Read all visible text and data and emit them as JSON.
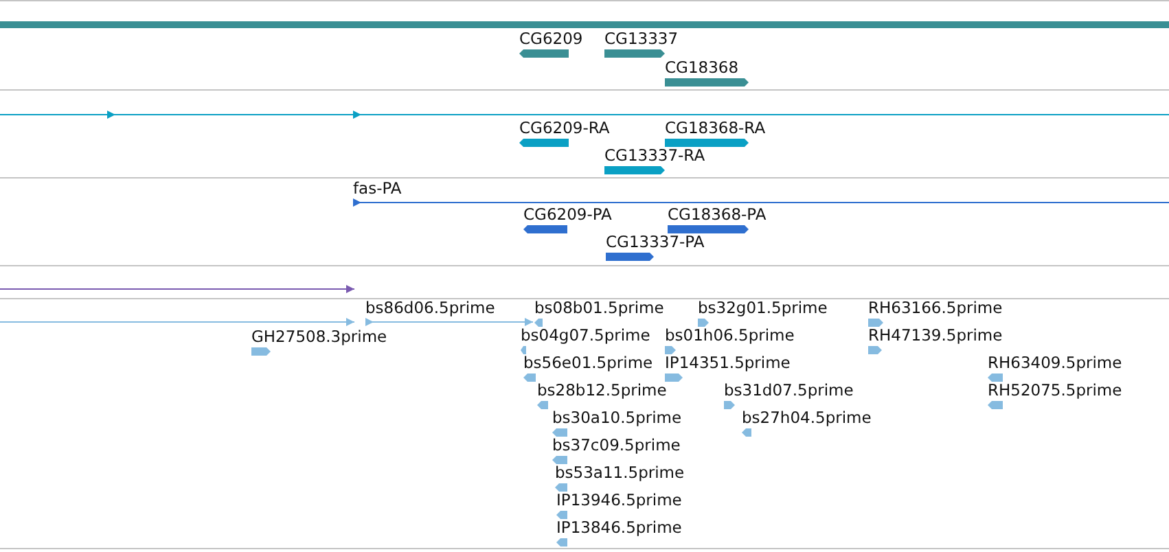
{
  "tracks": [
    {
      "color": "#3a8f94",
      "features": [
        {
          "kind": "band"
        },
        {
          "kind": "block",
          "label": "CG6209",
          "reverse": true
        },
        {
          "kind": "block",
          "label": "CG13337",
          "reverse": false
        },
        {
          "kind": "block",
          "label": "CG18368",
          "reverse": false
        }
      ]
    },
    {
      "color": "#0aa0c4",
      "features": [
        {
          "kind": "line",
          "reverse": false
        },
        {
          "kind": "block",
          "label": "CG6209-RA",
          "reverse": true
        },
        {
          "kind": "block",
          "label": "CG18368-RA",
          "reverse": false
        },
        {
          "kind": "block",
          "label": "CG13337-RA",
          "reverse": false
        }
      ]
    },
    {
      "color": "#2f6fcf",
      "features": [
        {
          "kind": "line",
          "label": "fas-PA",
          "reverse": false
        },
        {
          "kind": "block",
          "label": "CG6209-PA",
          "reverse": true
        },
        {
          "kind": "block",
          "label": "CG18368-PA",
          "reverse": false
        },
        {
          "kind": "block",
          "label": "CG13337-PA",
          "reverse": false
        }
      ]
    },
    {
      "color": "#7a5ab0",
      "features": [
        {
          "kind": "line",
          "reverse": false
        }
      ]
    },
    {
      "color": "#86bbe0",
      "features": [
        {
          "kind": "line",
          "reverse": false
        },
        {
          "kind": "line",
          "label": "bs86d06.5prime",
          "reverse": false
        },
        {
          "kind": "block",
          "label": "bs08b01.5prime",
          "reverse": true
        },
        {
          "kind": "block",
          "label": "bs32g01.5prime",
          "reverse": false
        },
        {
          "kind": "block",
          "label": "RH63166.5prime",
          "reverse": false
        },
        {
          "kind": "block",
          "label": "GH27508.3prime",
          "reverse": false
        },
        {
          "kind": "block",
          "label": "bs04g07.5prime",
          "reverse": true
        },
        {
          "kind": "block",
          "label": "bs01h06.5prime",
          "reverse": false
        },
        {
          "kind": "block",
          "label": "RH47139.5prime",
          "reverse": false
        },
        {
          "kind": "block",
          "label": "bs56e01.5prime",
          "reverse": true
        },
        {
          "kind": "block",
          "label": "IP14351.5prime",
          "reverse": false
        },
        {
          "kind": "block",
          "label": "RH63409.5prime",
          "reverse": true
        },
        {
          "kind": "block",
          "label": "bs28b12.5prime",
          "reverse": true
        },
        {
          "kind": "block",
          "label": "bs31d07.5prime",
          "reverse": false
        },
        {
          "kind": "block",
          "label": "RH52075.5prime",
          "reverse": true
        },
        {
          "kind": "block",
          "label": "bs30a10.5prime",
          "reverse": true
        },
        {
          "kind": "block",
          "label": "bs27h04.5prime",
          "reverse": true
        },
        {
          "kind": "block",
          "label": "bs37c09.5prime",
          "reverse": true
        },
        {
          "kind": "block",
          "label": "bs53a11.5prime",
          "reverse": true
        },
        {
          "kind": "block",
          "label": "IP13946.5prime",
          "reverse": true
        },
        {
          "kind": "block",
          "label": "IP13846.5prime",
          "reverse": true
        }
      ]
    }
  ]
}
